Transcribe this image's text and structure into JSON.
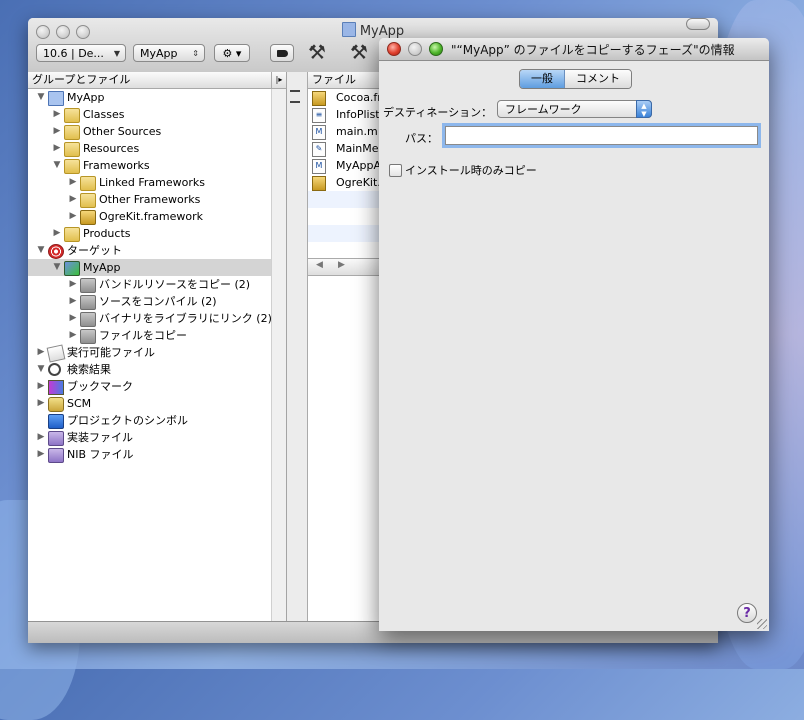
{
  "main_window": {
    "title": "MyApp",
    "sdk_popup": "10.6 | De...",
    "target_popup": "MyApp",
    "sidebar_header": "グループとファイル",
    "tree": [
      {
        "label": "MyApp",
        "indent": 0,
        "tri": "▼",
        "icon": "project-icon"
      },
      {
        "label": "Classes",
        "indent": 1,
        "tri": "▶",
        "icon": "folder-icon"
      },
      {
        "label": "Other Sources",
        "indent": 1,
        "tri": "▶",
        "icon": "folder-icon"
      },
      {
        "label": "Resources",
        "indent": 1,
        "tri": "▶",
        "icon": "folder-icon"
      },
      {
        "label": "Frameworks",
        "indent": 1,
        "tri": "▼",
        "icon": "folder-icon"
      },
      {
        "label": "Linked Frameworks",
        "indent": 2,
        "tri": "▶",
        "icon": "folder-icon"
      },
      {
        "label": "Other Frameworks",
        "indent": 2,
        "tri": "▶",
        "icon": "folder-icon"
      },
      {
        "label": "OgreKit.framework",
        "indent": 2,
        "tri": "▶",
        "icon": "framework-icon"
      },
      {
        "label": "Products",
        "indent": 1,
        "tri": "▶",
        "icon": "folder-icon"
      },
      {
        "label": "ターゲット",
        "indent": 0,
        "tri": "▼",
        "icon": "target-icon"
      },
      {
        "label": "MyApp",
        "indent": 1,
        "tri": "▼",
        "icon": "app-target-icon",
        "selected": true
      },
      {
        "label": "バンドルリソースをコピー (2)",
        "indent": 2,
        "tri": "▶",
        "icon": "build-phase-icon"
      },
      {
        "label": "ソースをコンパイル (2)",
        "indent": 2,
        "tri": "▶",
        "icon": "build-phase-icon"
      },
      {
        "label": "バイナリをライブラリにリンク (2)",
        "indent": 2,
        "tri": "▶",
        "icon": "build-phase-icon"
      },
      {
        "label": "ファイルをコピー",
        "indent": 2,
        "tri": "▶",
        "icon": "build-phase-icon"
      },
      {
        "label": "実行可能ファイル",
        "indent": 0,
        "tri": "▶",
        "icon": "executable-icon"
      },
      {
        "label": "検索結果",
        "indent": 0,
        "tri": "▼",
        "icon": "magnifier-icon"
      },
      {
        "label": "ブックマーク",
        "indent": 0,
        "tri": "▶",
        "icon": "bookmark-icon"
      },
      {
        "label": "SCM",
        "indent": 0,
        "tri": "▶",
        "icon": "scm-icon"
      },
      {
        "label": "プロジェクトのシンボル",
        "indent": 0,
        "tri": "",
        "icon": "symbols-icon"
      },
      {
        "label": "実装ファイル",
        "indent": 0,
        "tri": "▶",
        "icon": "smart-group-icon"
      },
      {
        "label": "NIB ファイル",
        "indent": 0,
        "tri": "▶",
        "icon": "smart-group-icon"
      }
    ],
    "filelist_header": "ファイル",
    "files": [
      {
        "label": "Cocoa.fr",
        "kind": "fw",
        "icon": "framework-file-icon"
      },
      {
        "label": "InfoPlist",
        "kind": "doc",
        "icon": "plist-file-icon"
      },
      {
        "label": "main.m",
        "kind": "m",
        "icon": "m-file-icon"
      },
      {
        "label": "MainMen",
        "kind": "xib",
        "icon": "xib-file-icon"
      },
      {
        "label": "MyAppA",
        "kind": "m",
        "icon": "m-file-icon"
      },
      {
        "label": "OgreKit.",
        "kind": "fw",
        "icon": "framework-file-icon"
      }
    ]
  },
  "info_panel": {
    "title": "\"“MyApp” のファイルをコピーするフェーズ\"の情報",
    "tabs": [
      {
        "label": "一般",
        "active": true
      },
      {
        "label": "コメント",
        "active": false
      }
    ],
    "destination_label": "デスティネーション：",
    "destination_value": "フレームワーク",
    "path_label": "パス：",
    "path_value": "",
    "checkbox_label": "インストール時のみコピー",
    "checkbox_checked": false,
    "help_label": "?"
  }
}
